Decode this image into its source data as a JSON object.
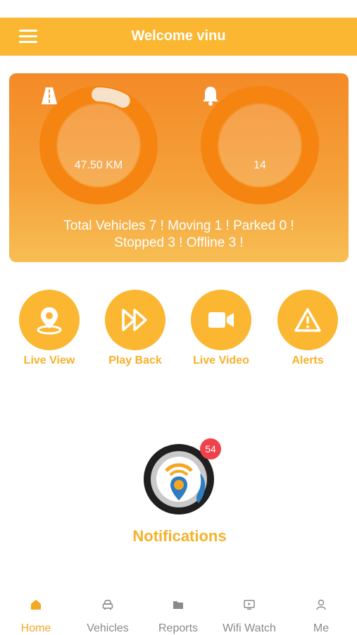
{
  "header": {
    "title": "Welcome vinu",
    "menu_icon": "hamburger-menu-icon"
  },
  "stats": {
    "distance": "47.50 KM",
    "distance_progress": 0.08,
    "distance_icon": "road-icon",
    "alerts": "14",
    "alerts_icon": "bell-icon",
    "summary_line1": "Total Vehicles 7 ! Moving 1 ! Parked 0 !",
    "summary_line2": "Stopped 3 ! Offline 3 !"
  },
  "actions": [
    {
      "label": "Live View",
      "icon": "location-pin-icon"
    },
    {
      "label": "Play Back",
      "icon": "fast-forward-icon"
    },
    {
      "label": "Live Video",
      "icon": "video-camera-icon"
    },
    {
      "label": "Alerts",
      "icon": "warning-icon"
    }
  ],
  "notifications": {
    "label": "Notifications",
    "badge": "54"
  },
  "bottom_nav": [
    {
      "label": "Home",
      "icon": "home-icon",
      "active": true
    },
    {
      "label": "Vehicles",
      "icon": "car-icon",
      "active": false
    },
    {
      "label": "Reports",
      "icon": "folder-icon",
      "active": false
    },
    {
      "label": "Wifi Watch",
      "icon": "tv-icon",
      "active": false
    },
    {
      "label": "Me",
      "icon": "user-icon",
      "active": false
    }
  ],
  "colors": {
    "accent": "#fbb731",
    "card_top": "#f48a27",
    "badge": "#f0424b",
    "inactive": "#8a8a8a"
  }
}
